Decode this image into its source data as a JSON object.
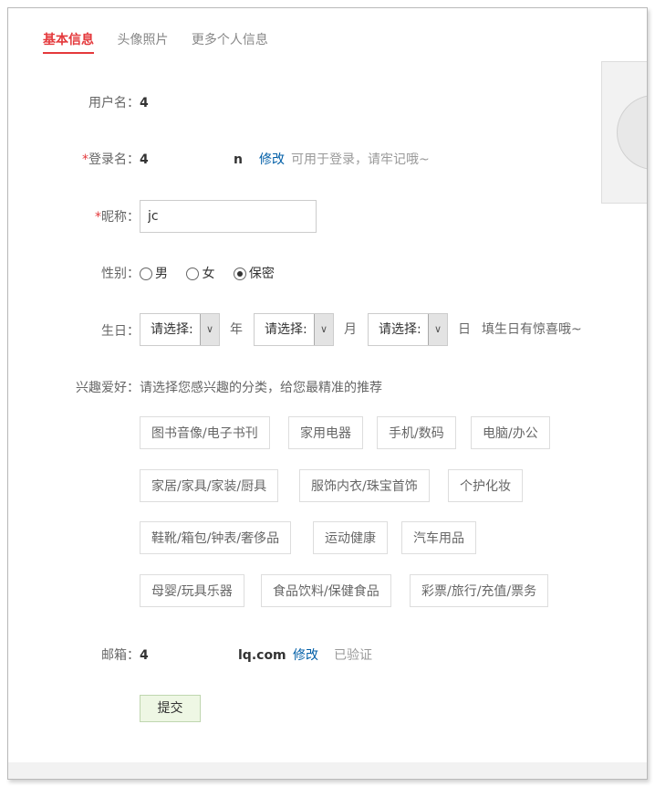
{
  "tabs": [
    "基本信息",
    "头像照片",
    "更多个人信息"
  ],
  "username": {
    "label": "用户名：",
    "value": "4"
  },
  "loginname": {
    "required": "*",
    "label": "登录名：",
    "value_start": "4",
    "value_end": "n",
    "edit": "修改",
    "hint": "可用于登录，请牢记哦~"
  },
  "nickname": {
    "required": "*",
    "label": "昵称：",
    "value": "jc"
  },
  "gender": {
    "label": "性别：",
    "options": [
      "男",
      "女",
      "保密"
    ],
    "selected": "保密"
  },
  "birthday": {
    "label": "生日：",
    "year_select": "请选择:",
    "year_unit": "年",
    "month_select": "请选择:",
    "month_unit": "月",
    "day_select": "请选择:",
    "day_unit": "日",
    "hint": "填生日有惊喜哦~"
  },
  "interests": {
    "label": "兴趣爱好：",
    "hint": "请选择您感兴趣的分类，给您最精准的推荐",
    "categories": [
      "图书音像/电子书刊",
      "家用电器",
      "手机/数码",
      "电脑/办公",
      "家居/家具/家装/厨具",
      "服饰内衣/珠宝首饰",
      "个护化妆",
      "鞋靴/箱包/钟表/奢侈品",
      "运动健康",
      "汽车用品",
      "母婴/玩具乐器",
      "食品饮料/保健食品",
      "彩票/旅行/充值/票务"
    ]
  },
  "email": {
    "label": "邮箱：",
    "value_start": "4",
    "value_end": "lq.com",
    "edit": "修改",
    "status": "已验证"
  },
  "submit": "提交"
}
